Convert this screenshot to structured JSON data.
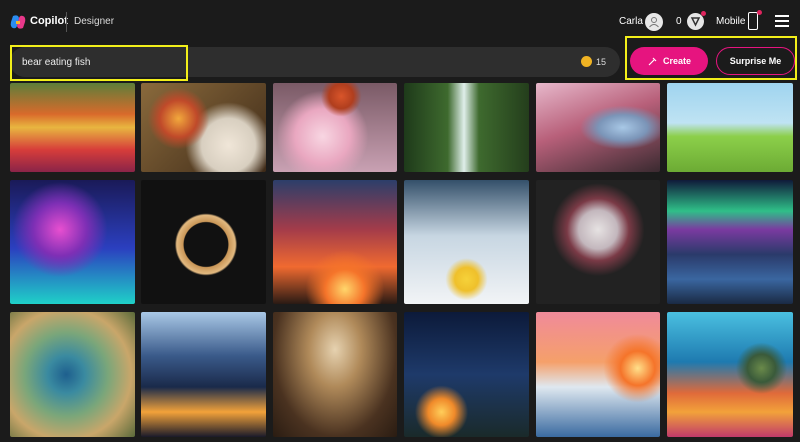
{
  "header": {
    "brand": "Copilot",
    "product": "Designer",
    "user_name": "Carla",
    "boost_count": "0",
    "mobile_label": "Mobile"
  },
  "search": {
    "value": "bear eating fish",
    "boosts": "15"
  },
  "actions": {
    "create_label": "Create",
    "surprise_label": "Surprise Me"
  },
  "colors": {
    "accent": "#e6147f",
    "highlight": "#f2ef1a",
    "background": "#1b1b1b"
  },
  "gallery": [
    {
      "name": "tulip-field"
    },
    {
      "name": "picnic-table"
    },
    {
      "name": "cherry-blossom-butterfly"
    },
    {
      "name": "forest-waterfall"
    },
    {
      "name": "blossom-river"
    },
    {
      "name": "kids-flying-kite"
    },
    {
      "name": "neon-forest"
    },
    {
      "name": "floral-crescent-moon"
    },
    {
      "name": "cowboy-sunset"
    },
    {
      "name": "polar-bears-lemonade"
    },
    {
      "name": "flower-bouquet"
    },
    {
      "name": "aurora-coast"
    },
    {
      "name": "peacock"
    },
    {
      "name": "city-night-skyline"
    },
    {
      "name": "library-reader"
    },
    {
      "name": "camping-night-sky"
    },
    {
      "name": "polar-bear-iceberg-sunset"
    },
    {
      "name": "coral-reef-turtle"
    }
  ]
}
